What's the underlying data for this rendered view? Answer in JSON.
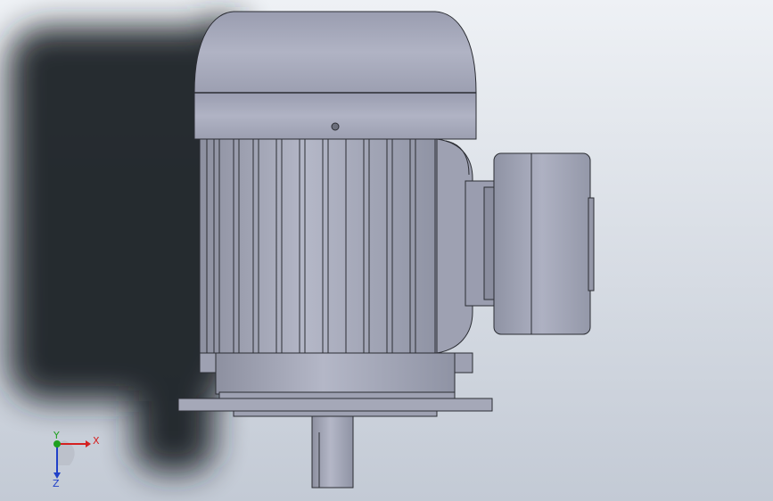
{
  "viewport": {
    "background_top": "#eef1f5",
    "background_bottom": "#c7ced8",
    "model_color": "#a8abbb",
    "model_shade": "#8e92a3",
    "outline_color": "#2b2d33",
    "shadow_color": "#1f2226"
  },
  "triad": {
    "x_label": "X",
    "y_label": "Y",
    "z_label": "Z",
    "x_color": "#d42020",
    "y_color": "#1fa01f",
    "z_color": "#2040c8"
  }
}
